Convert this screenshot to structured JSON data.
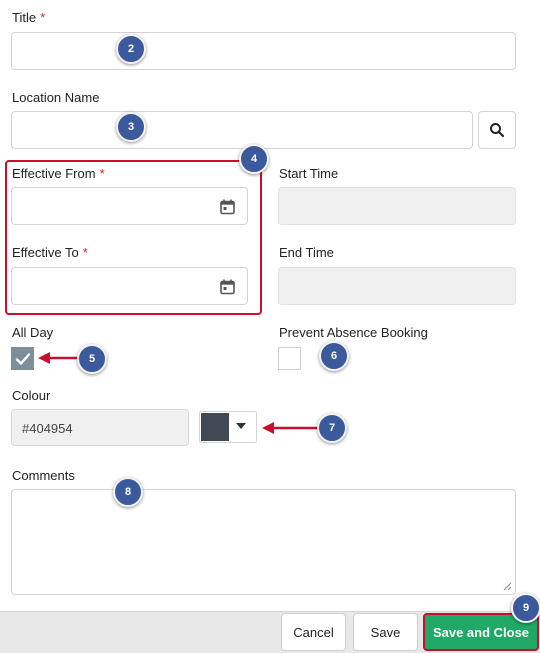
{
  "form": {
    "title_label": "Title",
    "required_mark": "*",
    "location_label": "Location Name",
    "effective_from_label": "Effective From",
    "effective_to_label": "Effective To",
    "start_time_label": "Start Time",
    "end_time_label": "End Time",
    "all_day_label": "All Day",
    "prevent_absence_label": "Prevent Absence Booking",
    "colour_label": "Colour",
    "colour_value": "#404954",
    "comments_label": "Comments",
    "all_day_checked": true,
    "prevent_absence_checked": false
  },
  "footer": {
    "cancel_label": "Cancel",
    "save_label": "Save",
    "save_close_label": "Save and Close"
  },
  "annotations": {
    "badge_2": "2",
    "badge_3": "3",
    "badge_4": "4",
    "badge_5": "5",
    "badge_6": "6",
    "badge_7": "7",
    "badge_8": "8",
    "badge_9": "9"
  },
  "icons": {
    "search": "search-icon",
    "calendar": "calendar-icon",
    "check": "check-icon",
    "caret": "caret-down-icon",
    "resize": "resize-handle-icon"
  },
  "colors": {
    "swatch": "#404954",
    "highlight": "#c8102e",
    "badge": "#3b5a9c",
    "primary_button": "#1fa866",
    "checkbox_checked": "#7c8e97"
  }
}
